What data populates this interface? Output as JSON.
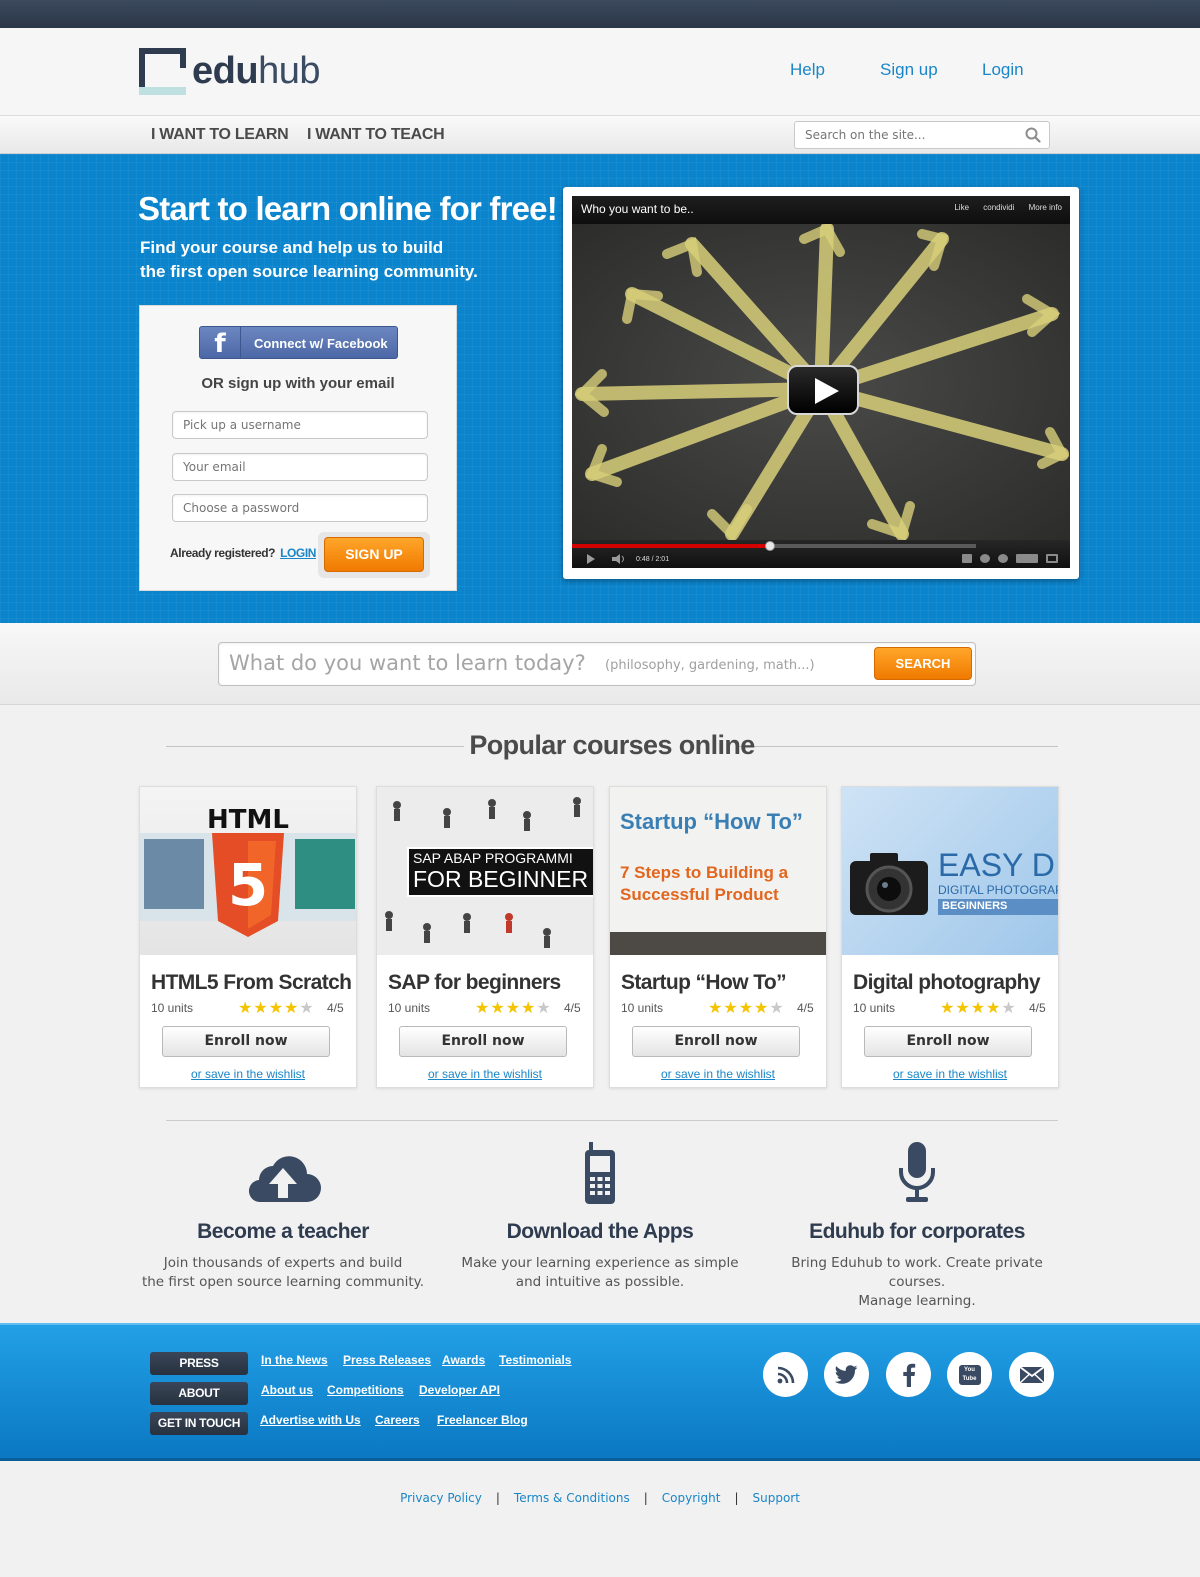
{
  "brand": {
    "logo_bold": "edu",
    "logo_light": "hub"
  },
  "header": {
    "links": [
      "Help",
      "Sign up",
      "Login"
    ]
  },
  "nav": {
    "items": [
      "I WANT TO LEARN",
      "I WANT TO TEACH"
    ],
    "search_placeholder": "Search on the site..."
  },
  "hero": {
    "title": "Start to learn online for free!",
    "subtitle_line1": "Find your course and help us to build",
    "subtitle_line2": "the first open source learning community.",
    "facebook_label": "Connect w/ Facebook",
    "or_text": "OR sign up with your email",
    "username_placeholder": "Pick up a username",
    "email_placeholder": "Your email",
    "password_placeholder": "Choose a password",
    "already_text": "Already registered?",
    "login_link": "LOGIN",
    "signup_button": "SIGN UP"
  },
  "video": {
    "title": "Who you want to be..",
    "actions": [
      "Like",
      "condividi",
      "More info"
    ],
    "time": "0:48 / 2:01",
    "progress": 0.49
  },
  "main_search": {
    "placeholder": "What do you want to learn today?",
    "hint": "(philosophy, gardening, math...)",
    "button": "SEARCH"
  },
  "courses": {
    "section_title": "Popular courses online",
    "enroll_label": "Enroll now",
    "wishlist_label": "or save in the wishlist",
    "items": [
      {
        "title": "HTML5 From Scratch",
        "units": "10 units",
        "rating": "4/5",
        "stars": 4,
        "thumb_text": "HTML"
      },
      {
        "title": "SAP for beginners",
        "units": "10 units",
        "rating": "4/5",
        "stars": 4,
        "thumb_text_1": "SAP ABAP PROGRAMMI",
        "thumb_text_2": "FOR BEGINNER"
      },
      {
        "title": "Startup “How To”",
        "units": "10 units",
        "rating": "4/5",
        "stars": 4,
        "thumb_text_1": "Startup “How To”",
        "thumb_text_2": "7 Steps to Building a",
        "thumb_text_3": "Successful Product"
      },
      {
        "title": "Digital photography",
        "units": "10 units",
        "rating": "4/5",
        "stars": 4,
        "thumb_text_1": "EASY D",
        "thumb_text_2": "DIGITAL PHOTOGRAP",
        "thumb_text_3": "BEGINNERS"
      }
    ]
  },
  "features": [
    {
      "icon": "cloud-upload-icon",
      "title": "Become a teacher",
      "line1": "Join thousands of experts and  build",
      "line2": "the first open source learning community."
    },
    {
      "icon": "mobile-phone-icon",
      "title": "Download the Apps",
      "line1": "Make your learning experience as simple",
      "line2": "and intuitive as possible."
    },
    {
      "icon": "microphone-icon",
      "title": "Eduhub for corporates",
      "line1": "Bring Eduhub to work. Create private courses.",
      "line2": "Manage learning."
    }
  ],
  "footer": {
    "groups": [
      {
        "label": "PRESS",
        "links": [
          "In the News",
          "Press Releases",
          "Awards",
          "Testimonials"
        ]
      },
      {
        "label": "ABOUT",
        "links": [
          "About us",
          "Competitions",
          "Developer API"
        ]
      },
      {
        "label": "GET IN TOUCH",
        "links": [
          "Advertise with Us",
          "Careers",
          "Freelancer Blog"
        ]
      }
    ],
    "social": [
      "rss-icon",
      "twitter-icon",
      "facebook-icon",
      "youtube-icon",
      "email-icon"
    ],
    "youtube_text": "You Tube"
  },
  "bottom_links": [
    "Privacy Policy",
    "Terms & Conditions",
    "Copyright",
    "Support"
  ],
  "colors": {
    "primary_blue": "#0a84cc",
    "accent_orange": "#f07a00",
    "dark_navy": "#2f3c50"
  }
}
